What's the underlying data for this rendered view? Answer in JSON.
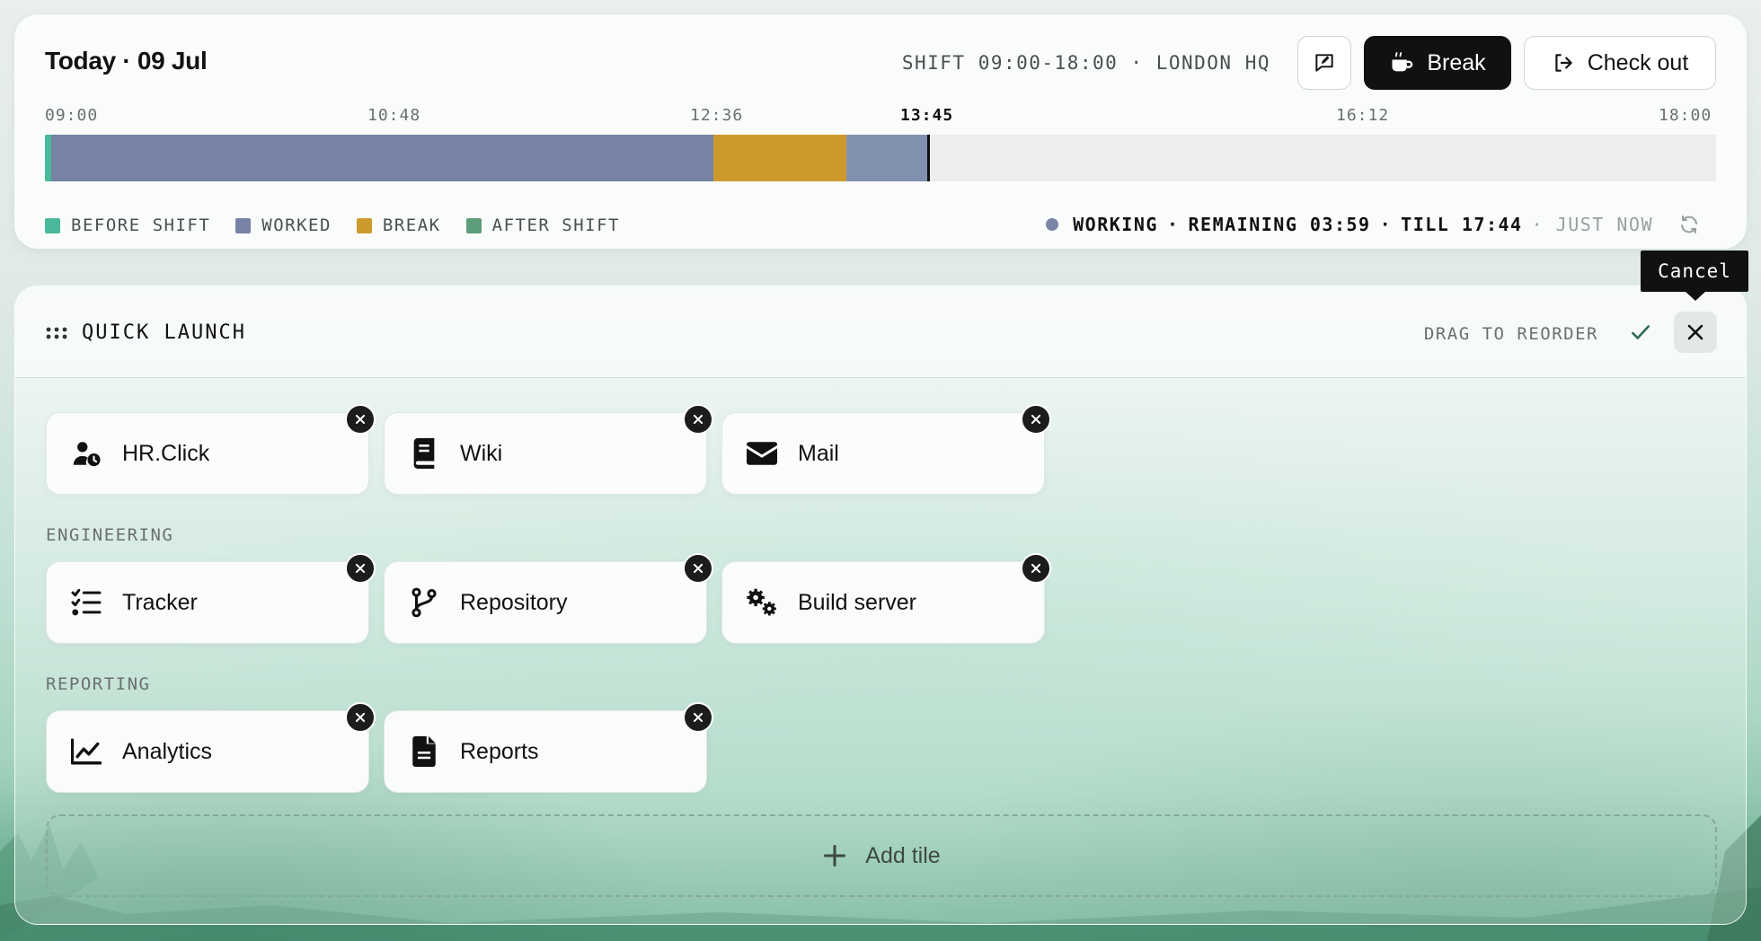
{
  "header": {
    "title": "Today · 09 Jul",
    "shift": "SHIFT 09:00-18:00 · LONDON HQ",
    "break_label": "Break",
    "checkout_label": "Check out",
    "icons": {
      "note": "comment-edit-icon",
      "break": "coffee-cup-icon",
      "checkout": "sign-out-icon"
    }
  },
  "timeline": {
    "start": "09:00",
    "end": "18:00",
    "ticks": [
      "09:00",
      "10:48",
      "12:36",
      "13:45",
      "16:12",
      "18:00"
    ],
    "current_time": "13:45",
    "segments": [
      {
        "type": "before",
        "from": "09:00",
        "to": "09:02"
      },
      {
        "type": "worked",
        "from": "09:02",
        "to": "12:36"
      },
      {
        "type": "break",
        "from": "12:36",
        "to": "13:19"
      },
      {
        "type": "worked",
        "from": "13:19",
        "to": "13:45"
      }
    ],
    "colors": {
      "before": "#4ab89a",
      "worked": "#7683a6",
      "break": "#cc9a2c",
      "after": "#5c9e7a",
      "empty": "#eceeed"
    }
  },
  "legend": [
    {
      "label": "BEFORE SHIFT",
      "color": "#4ab89a"
    },
    {
      "label": "WORKED",
      "color": "#7683a6"
    },
    {
      "label": "BREAK",
      "color": "#cc9a2c"
    },
    {
      "label": "AFTER SHIFT",
      "color": "#5c9e7a"
    }
  ],
  "status": {
    "state": "WORKING",
    "sep": "·",
    "remaining": "REMAINING 03:59",
    "till": "TILL 17:44",
    "updated": "· JUST NOW",
    "refresh_icon": "refresh-icon"
  },
  "quick_launch": {
    "title": "QUICK LAUNCH",
    "drag_hint": "DRAG TO REORDER",
    "tooltip": "Cancel",
    "add_tile": "Add tile",
    "groups": [
      {
        "label": "",
        "tiles": [
          {
            "name": "HR.Click",
            "icon": "user-clock-icon"
          },
          {
            "name": "Wiki",
            "icon": "book-icon"
          },
          {
            "name": "Mail",
            "icon": "envelope-icon"
          }
        ]
      },
      {
        "label": "ENGINEERING",
        "tiles": [
          {
            "name": "Tracker",
            "icon": "list-check-icon"
          },
          {
            "name": "Repository",
            "icon": "code-branch-icon"
          },
          {
            "name": "Build server",
            "icon": "gears-icon"
          }
        ]
      },
      {
        "label": "REPORTING",
        "tiles": [
          {
            "name": "Analytics",
            "icon": "chart-line-icon"
          },
          {
            "name": "Reports",
            "icon": "file-lines-icon"
          }
        ]
      }
    ]
  }
}
